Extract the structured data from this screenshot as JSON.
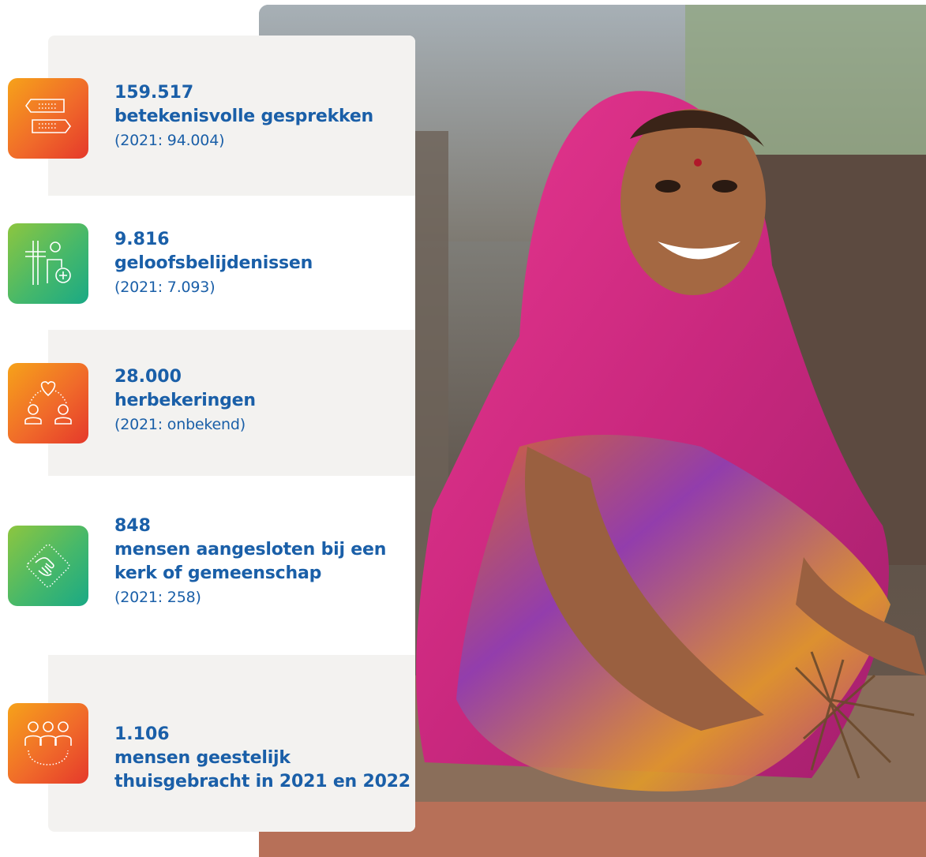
{
  "stats": [
    {
      "number": "159.517",
      "label": "betekenisvolle gesprekken",
      "previous": "(2021: 94.004)",
      "icon": "speech-bubbles-icon",
      "color": "orange"
    },
    {
      "number": "9.816",
      "label": "geloofsbelijdenissen",
      "previous": "(2021: 7.093)",
      "icon": "cross-person-icon",
      "color": "green"
    },
    {
      "number": "28.000",
      "label": "herbekeringen",
      "previous": "(2021: onbekend)",
      "icon": "heart-people-icon",
      "color": "orange"
    },
    {
      "number": "848",
      "label": "mensen aangesloten bij een kerk of gemeenschap",
      "previous": "(2021: 258)",
      "icon": "joined-hands-icon",
      "color": "green"
    },
    {
      "number": "1.106",
      "label": "mensen geestelijk thuisgebracht in 2021 en 2022",
      "previous": "",
      "icon": "group-icon",
      "color": "orange"
    }
  ],
  "colors": {
    "text": "#1a5fa8",
    "orange": "#f06a2a",
    "green": "#46b86a",
    "band": "#f3f2f0"
  }
}
